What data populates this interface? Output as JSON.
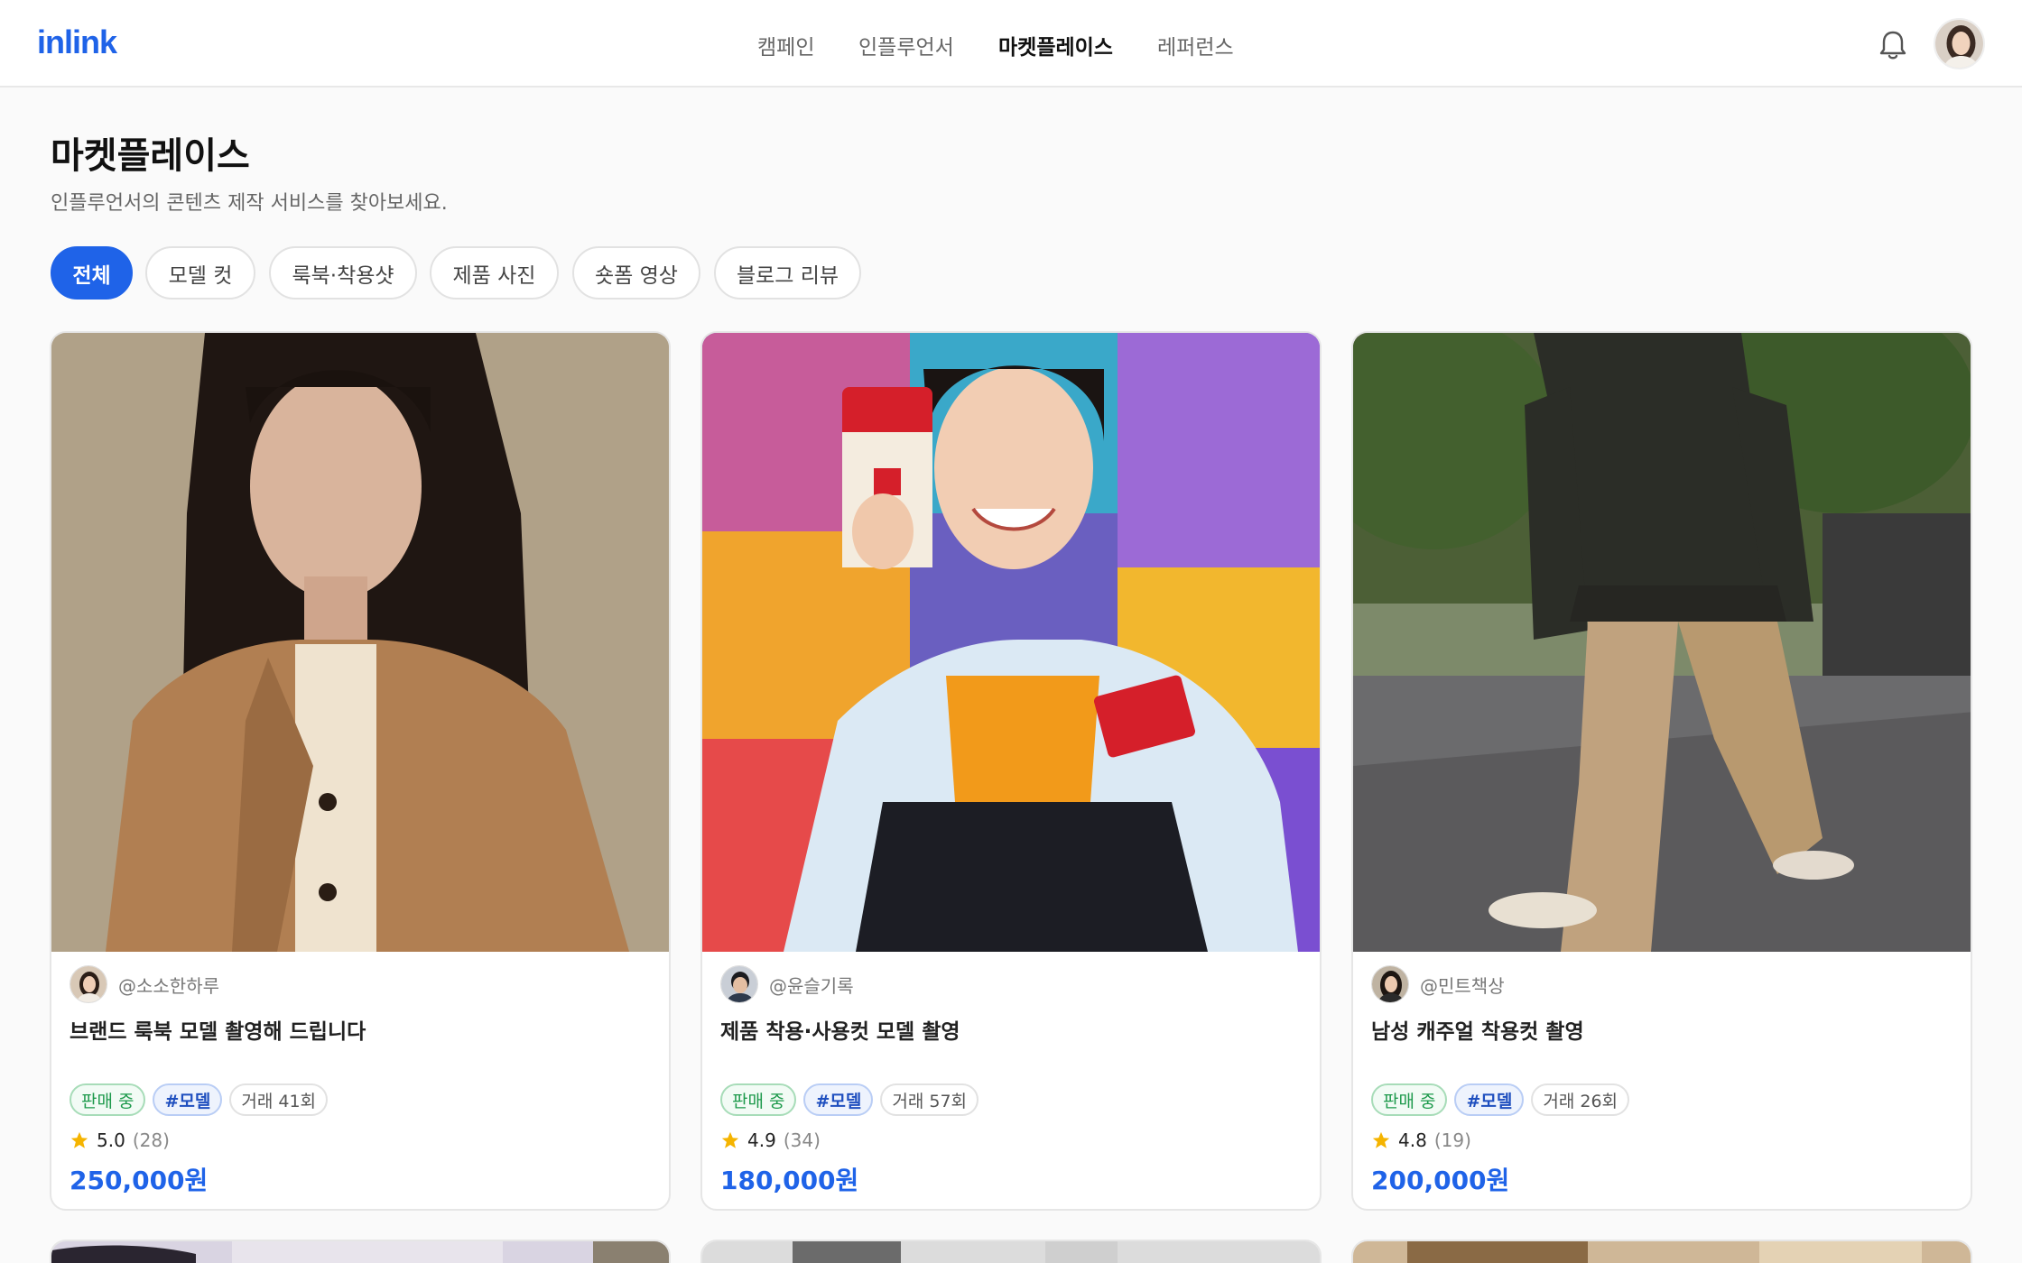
{
  "header": {
    "logo": "inlink",
    "nav": [
      {
        "label": "캠페인",
        "active": false
      },
      {
        "label": "인플루언서",
        "active": false
      },
      {
        "label": "마켓플레이스",
        "active": true
      },
      {
        "label": "레퍼런스",
        "active": false
      }
    ],
    "icons": {
      "notifications": "bell-icon",
      "profile": "user-avatar"
    }
  },
  "page": {
    "title": "마켓플레이스",
    "subtitle": "인플루언서의 콘텐츠 제작 서비스를 찾아보세요."
  },
  "filters": [
    {
      "label": "전체",
      "active": true
    },
    {
      "label": "모델 컷",
      "active": false
    },
    {
      "label": "룩북·착용샷",
      "active": false
    },
    {
      "label": "제품 사진",
      "active": false
    },
    {
      "label": "숏폼 영상",
      "active": false
    },
    {
      "label": "블로그 리뷰",
      "active": false
    }
  ],
  "listings": [
    {
      "handle": "@소소한하루",
      "title": "브랜드 룩북 모델 촬영해 드립니다",
      "status": "판매 중",
      "category": "#모델",
      "deals": "거래 41회",
      "rating": "5.0",
      "reviews": "(28)",
      "price": "250,000원"
    },
    {
      "handle": "@윤슬기록",
      "title": "제품 착용·사용컷 모델 촬영",
      "status": "판매 중",
      "category": "#모델",
      "deals": "거래 57회",
      "rating": "4.9",
      "reviews": "(34)",
      "price": "180,000원"
    },
    {
      "handle": "@민트책상",
      "title": "남성 캐주얼 착용컷 촬영",
      "status": "판매 중",
      "category": "#모델",
      "deals": "거래 26회",
      "rating": "4.8",
      "reviews": "(19)",
      "price": "200,000원"
    }
  ],
  "colors": {
    "accent": "#1f63e8",
    "sale_green": "#1e9a4c",
    "star": "#f5b400"
  }
}
